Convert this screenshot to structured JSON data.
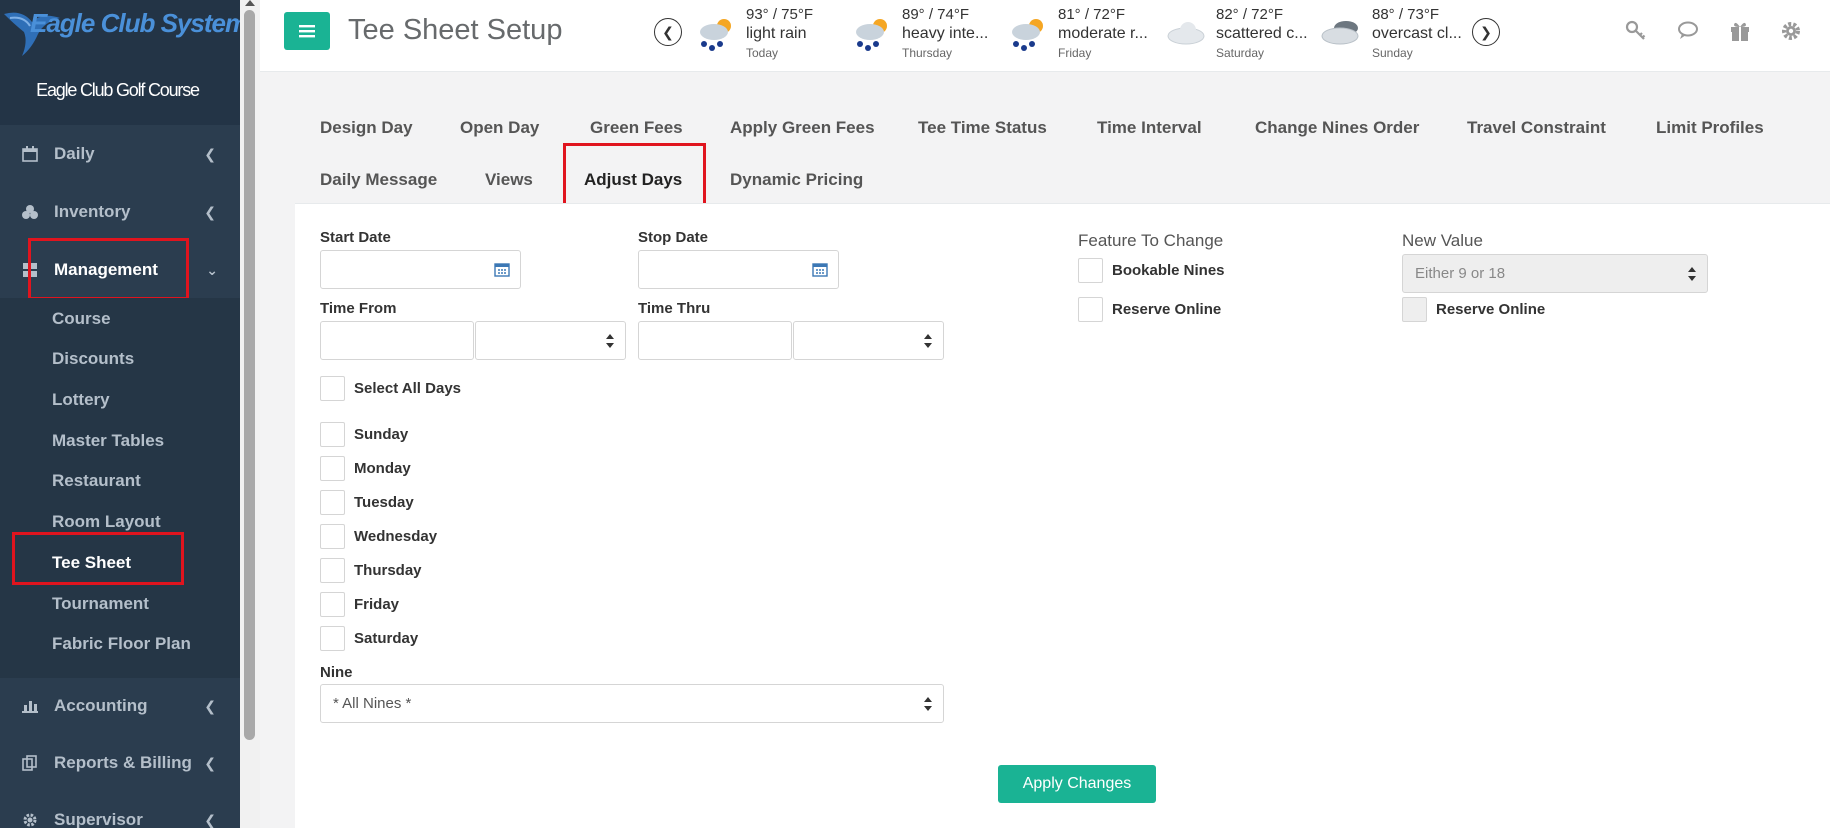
{
  "sidebar": {
    "brand": "Eagle Club Systems",
    "course_name": "Eagle Club Golf Course",
    "nav": [
      {
        "label": "Daily",
        "icon": "calendar-icon"
      },
      {
        "label": "Inventory",
        "icon": "cubes-icon"
      },
      {
        "label": "Management",
        "icon": "grid-icon"
      },
      {
        "label": "Accounting",
        "icon": "bar-chart-icon"
      },
      {
        "label": "Reports & Billing",
        "icon": "copy-icon"
      },
      {
        "label": "Supervisor",
        "icon": "gear-icon"
      }
    ],
    "management_items": [
      "Course",
      "Discounts",
      "Lottery",
      "Master Tables",
      "Restaurant",
      "Room Layout",
      "Tee Sheet",
      "Tournament",
      "Fabric Floor Plan"
    ],
    "selected_item": "Tee Sheet"
  },
  "header": {
    "title": "Tee Sheet Setup",
    "weather": [
      {
        "temp": "93° / 75°F",
        "desc": "light rain",
        "day": "Today",
        "icon": "rain-sun-icon"
      },
      {
        "temp": "89° / 74°F",
        "desc": "heavy inte...",
        "day": "Thursday",
        "icon": "rain-sun-icon"
      },
      {
        "temp": "81° / 72°F",
        "desc": "moderate r...",
        "day": "Friday",
        "icon": "rain-sun-icon"
      },
      {
        "temp": "82° / 72°F",
        "desc": "scattered c...",
        "day": "Saturday",
        "icon": "cloud-icon"
      },
      {
        "temp": "88° / 73°F",
        "desc": "overcast cl...",
        "day": "Sunday",
        "icon": "dark-cloud-icon"
      }
    ]
  },
  "tabs": {
    "row1": [
      "Design Day",
      "Open Day",
      "Green Fees",
      "Apply Green Fees",
      "Tee Time Status",
      "Time Interval",
      "Change Nines Order",
      "Travel Constraint",
      "Limit Profiles"
    ],
    "row2": [
      "Daily Message",
      "Views",
      "Adjust Days",
      "Dynamic Pricing"
    ],
    "active": "Adjust Days"
  },
  "form": {
    "start_date_label": "Start Date",
    "stop_date_label": "Stop Date",
    "time_from_label": "Time From",
    "time_thru_label": "Time Thru",
    "select_all_label": "Select All Days",
    "days": [
      "Sunday",
      "Monday",
      "Tuesday",
      "Wednesday",
      "Thursday",
      "Friday",
      "Saturday"
    ],
    "nine_label": "Nine",
    "nine_value": "* All Nines *",
    "feature_label": "Feature To Change",
    "features": [
      "Bookable Nines",
      "Reserve Online"
    ],
    "new_value_label": "New Value",
    "new_value_placeholder": "Either 9 or 18",
    "new_value_checkbox_label": "Reserve Online",
    "apply_label": "Apply Changes"
  }
}
